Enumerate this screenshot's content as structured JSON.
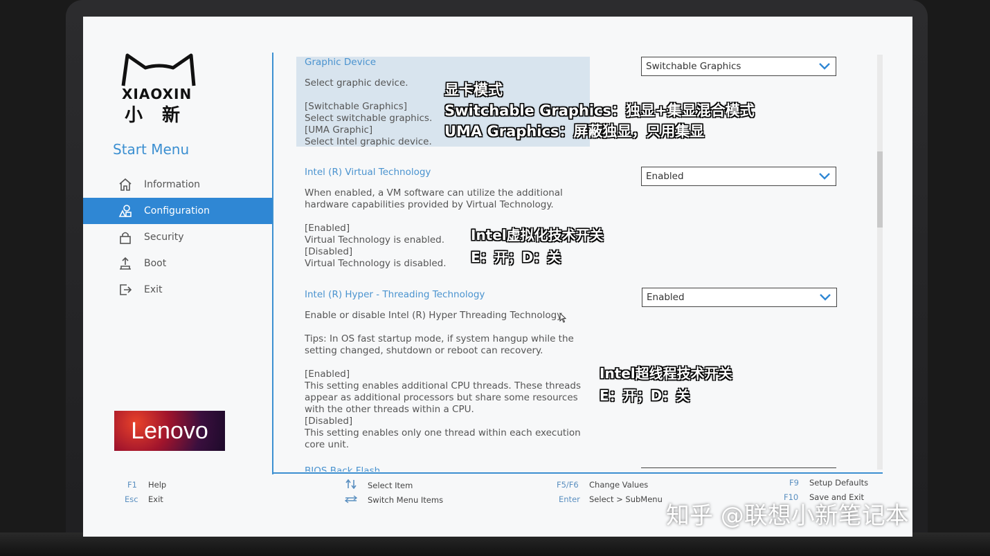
{
  "sidebar": {
    "logo_text": "XIAOXIN",
    "logo_cn": "小新",
    "title": "Start Menu",
    "items": [
      {
        "label": "Information",
        "icon": "home-icon",
        "active": false
      },
      {
        "label": "Configuration",
        "icon": "config-icon",
        "active": true
      },
      {
        "label": "Security",
        "icon": "lock-icon",
        "active": false
      },
      {
        "label": "Boot",
        "icon": "boot-icon",
        "active": false
      },
      {
        "label": "Exit",
        "icon": "exit-icon",
        "active": false
      }
    ],
    "brand": "Lenovo"
  },
  "settings": [
    {
      "title": "Graphic Device",
      "description": "Select graphic device.\n\n[Switchable Graphics]\nSelect switchable graphics.\n[UMA Graphic]\nSelect Intel graphic device.",
      "value": "Switchable Graphics",
      "highlighted": true
    },
    {
      "title": "Intel (R) Virtual Technology",
      "description": "When enabled, a VM software can utilize the additional\nhardware capabilities provided by Virtual Technology.\n\n[Enabled]\nVirtual Technology is enabled.\n[Disabled]\nVirtual Technology is disabled.",
      "value": "Enabled"
    },
    {
      "title": "Intel (R) Hyper - Threading Technology",
      "description": "Enable or disable Intel (R) Hyper Threading Technology\n\nTips: In OS fast startup mode, if system hangup while the\nsetting changed, shutdown or reboot can recovery.\n\n[Enabled]\nThis setting enables additional CPU threads. These threads\nappear as additional processors but share some resources\nwith the other threads within a CPU.\n[Disabled]\nThis setting enables only one thread within each execution\ncore unit.",
      "value": "Enabled"
    },
    {
      "title": "BIOS Back Flash"
    }
  ],
  "annotations": {
    "graphics": [
      "显卡模式",
      "Switchable Graphics：独显+集显混合模式",
      "UMA Graphics：屏蔽独显，只用集显"
    ],
    "vt": [
      "Intel虚拟化技术开关",
      "E：开；D：关"
    ],
    "ht": [
      "Intel超线程技术开关",
      "E：开；D：关"
    ]
  },
  "footer": {
    "f1_key": "F1",
    "f1_label": "Help",
    "esc_key": "Esc",
    "esc_label": "Exit",
    "select_item": "Select Item",
    "switch_menu": "Switch Menu Items",
    "f5f6_key": "F5/F6",
    "f5f6_label": "Change Values",
    "enter_key": "Enter",
    "enter_label": "Select > SubMenu",
    "f9_key": "F9",
    "f9_label": "Setup Defaults",
    "f10_key": "F10",
    "f10_label": "Save and Exit"
  },
  "watermark": "知乎 @联想小新笔记本",
  "colors": {
    "accent": "#2f87d4",
    "title_blue": "#4a93cf",
    "highlight": "#d8e4ee"
  }
}
